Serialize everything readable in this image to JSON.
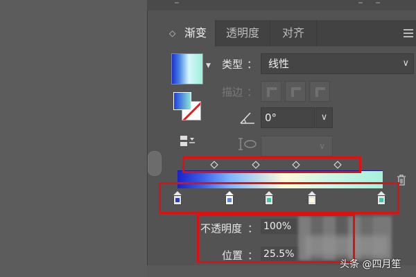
{
  "tabs": [
    {
      "label": "渐变",
      "toggle": "◇",
      "active": true
    },
    {
      "label": "透明度",
      "active": false
    },
    {
      "label": "对齐",
      "active": false
    }
  ],
  "icons": {
    "menu": "hamburger-menu-icon",
    "trash": "trash-icon",
    "angle": "angle-icon",
    "reverse": "reverse-gradient-icon",
    "aspect": "aspect-ratio-icon"
  },
  "gradient": {
    "type_label": "类型",
    "type_value": "线性",
    "stroke_label": "描边",
    "angle_value": "0°",
    "opacity_label": "不透明度",
    "opacity_value": "100%",
    "position_label": "位置",
    "position_value": "25.5%",
    "colon": "：",
    "colors": {
      "start": "#1a22c8",
      "blue": "#3a5fe8",
      "light_blue": "#7fb6ff",
      "cream": "#fffbd6",
      "mint": "#ccf6e6",
      "end": "#a6f2dc"
    }
  },
  "stops": [
    {
      "position": 0,
      "color": "#2b3bd0",
      "selected": false
    },
    {
      "position": 25.5,
      "color": "#5a86e8",
      "selected": true
    },
    {
      "position": 45,
      "color": "#3ac8a8",
      "selected": false
    },
    {
      "position": 66,
      "color": "#fffbd6",
      "selected": false
    },
    {
      "position": 100,
      "color": "#3ac8a8",
      "selected": false
    }
  ],
  "midpoints": [
    13,
    38,
    62,
    87
  ],
  "watermark": "头条 @四月笙",
  "highlight_color": "#e01010"
}
